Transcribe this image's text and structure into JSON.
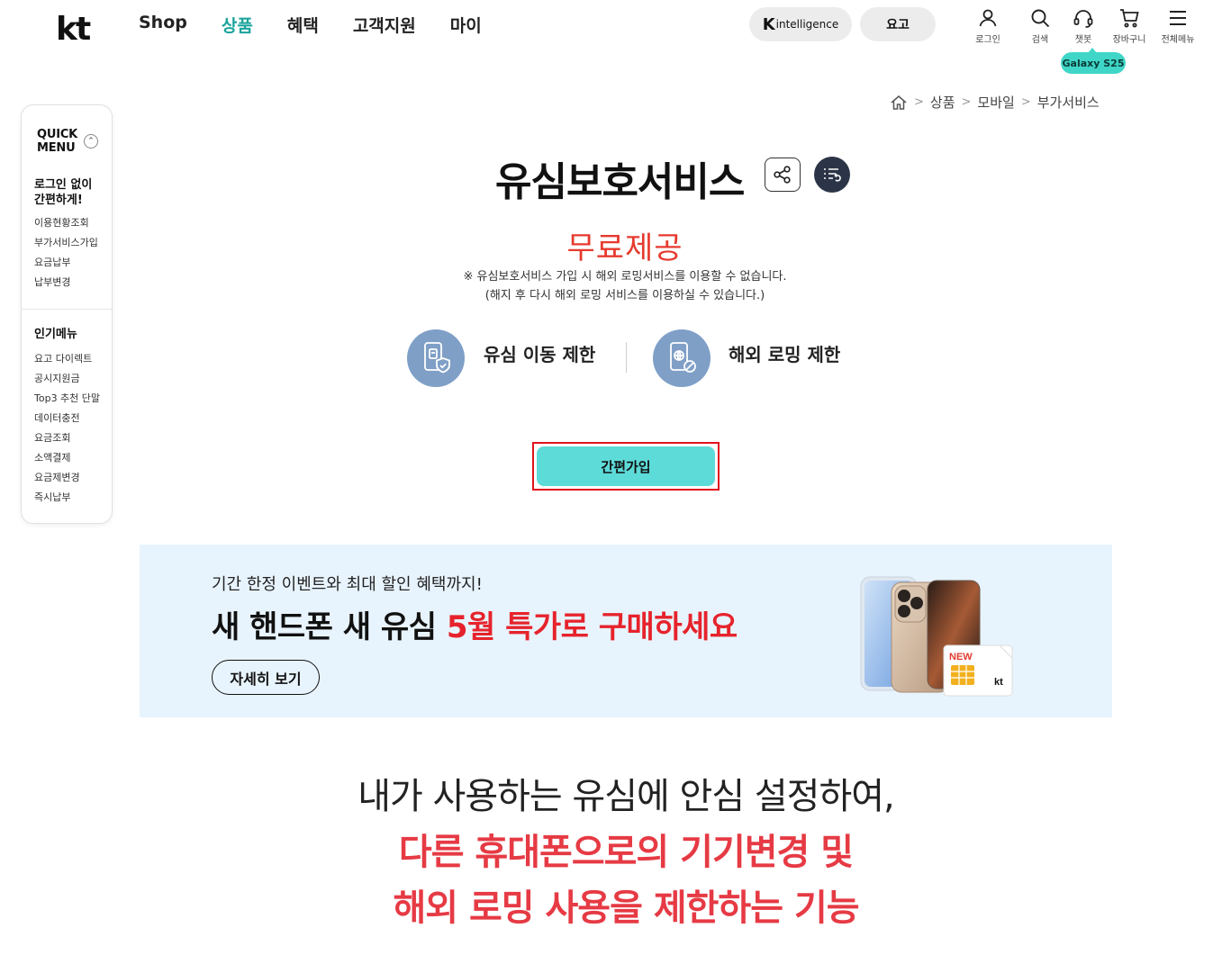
{
  "header": {
    "logo": "kt",
    "nav": [
      "Shop",
      "상품",
      "혜택",
      "고객지원",
      "마이"
    ],
    "nav_active": "상품",
    "k_intelligence_k": "K",
    "k_intelligence_text": "intelligence",
    "yogo_label": "요고",
    "utils": [
      {
        "icon": "person-icon",
        "label": "로그인"
      },
      {
        "icon": "search-icon",
        "label": "검색"
      },
      {
        "icon": "headset-icon",
        "label": "챗봇"
      },
      {
        "icon": "cart-icon",
        "label": "장바구니"
      },
      {
        "icon": "menu-icon",
        "label": "전체메뉴"
      }
    ],
    "galaxy_badge": "Galaxy S25"
  },
  "quick_menu": {
    "title_line1": "QUICK",
    "title_line2": "MENU",
    "section1_line1": "로그인 없이",
    "section1_line2": "간편하게!",
    "section1_links": [
      "이용현황조회",
      "부가서비스가입",
      "요금납부",
      "납부변경"
    ],
    "section2_title": "인기메뉴",
    "section2_links": [
      "요고 다이렉트",
      "공시지원금",
      "Top3 추천 단말",
      "데이터충전",
      "요금조회",
      "소액결제",
      "요금제변경",
      "즉시납부"
    ]
  },
  "breadcrumb": {
    "items": [
      "상품",
      "모바일",
      "부가서비스"
    ]
  },
  "product": {
    "title": "유심보호서비스",
    "price": "무료제공",
    "notice1": "※ 유심보호서비스 가입 시 해외 로밍서비스를 이용할 수 없습니다.",
    "notice2": "(해지 후 다시 해외 로밍 서비스를 이용하실 수 있습니다.)",
    "feature1": "유심 이동 제한",
    "feature2": "해외 로밍 제한",
    "join_label": "간편가입"
  },
  "banner": {
    "sub": "기간 한정 이벤트와 최대 할인 혜택까지!",
    "title_plain": "새 핸드폰 새 유심 ",
    "title_red": "5월 특가로 구매하세요",
    "button": "자세히 보기",
    "sim_new": "NEW",
    "sim_kt": "kt"
  },
  "message": {
    "line1": "내가 사용하는 유심에 안심 설정하여,",
    "line2": "다른 휴대폰으로의 기기변경 및",
    "line3": "해외 로밍 사용을 제한하는 기능"
  },
  "colors": {
    "accent_teal": "#1aa39c",
    "join_button": "#5ddbd9",
    "red": "#e63a2e",
    "banner_bg": "#e8f4fd",
    "feature_icon": "#7f9fc7"
  }
}
